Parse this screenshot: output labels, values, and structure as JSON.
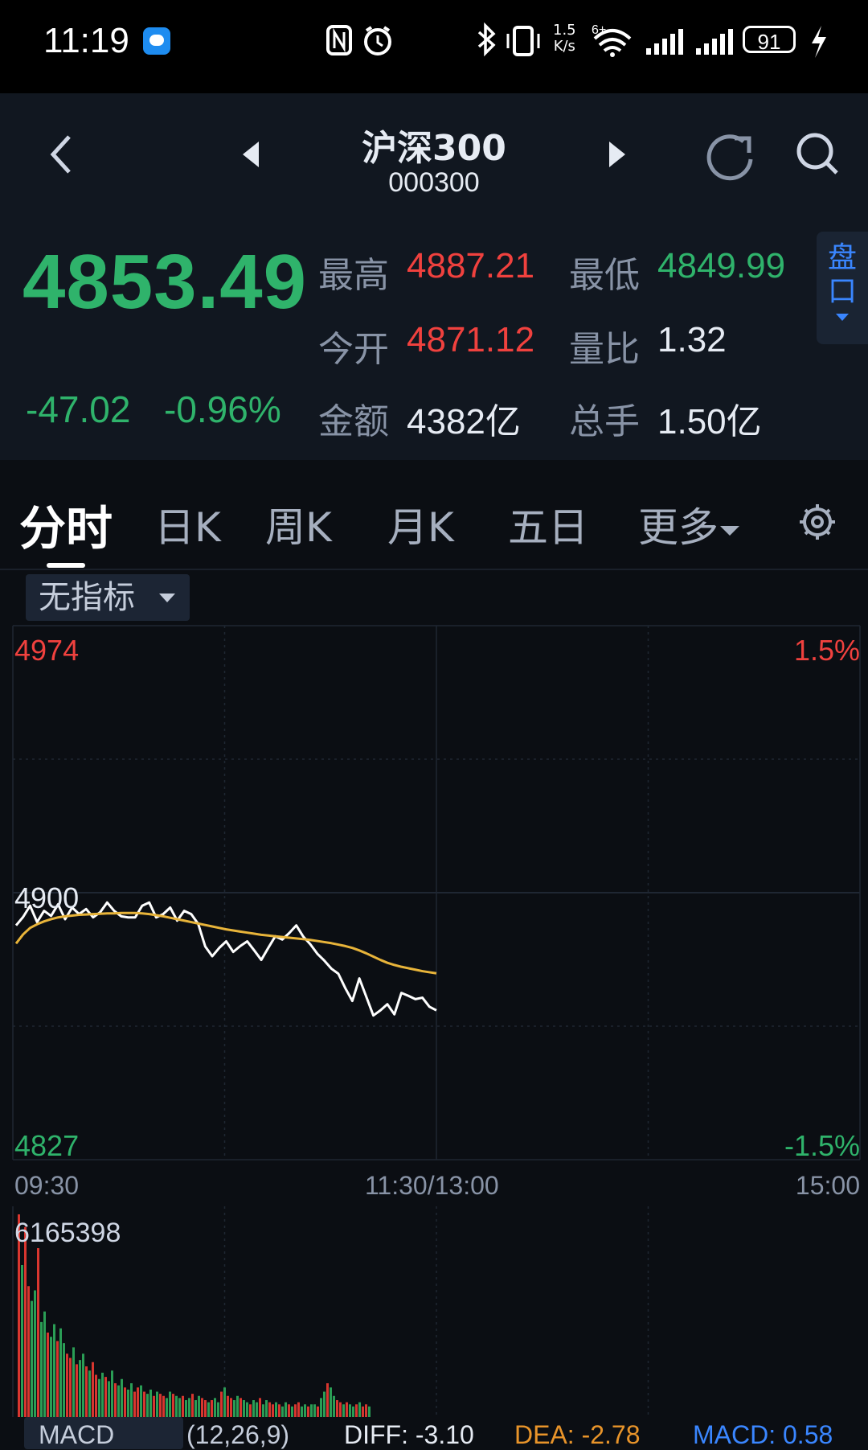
{
  "status_bar": {
    "time": "11:19",
    "net_speed_top": "1.5",
    "net_speed_bottom": "K/s",
    "battery": "91"
  },
  "header": {
    "title": "沪深300",
    "code": "000300",
    "back_icon": "chevron-left-icon",
    "prev_icon": "triangle-left-icon",
    "next_icon": "triangle-right-icon",
    "refresh_icon": "refresh-icon",
    "search_icon": "search-icon"
  },
  "quote": {
    "price": "4853.49",
    "change": "-47.02",
    "change_pct": "-0.96%",
    "stats": [
      {
        "label": "最高",
        "value": "4887.21"
      },
      {
        "label": "最低",
        "value": "4849.99"
      },
      {
        "label": "今开",
        "value": "4871.12"
      },
      {
        "label": "量比",
        "value": "1.32"
      },
      {
        "label": "金额",
        "value": "4382亿"
      },
      {
        "label": "总手",
        "value": "1.50亿"
      }
    ],
    "pankou_label_1": "盘",
    "pankou_label_2": "口",
    "colors": {
      "down": "#2fb36b",
      "up": "#f0413e"
    }
  },
  "tabs": [
    {
      "label": "分时",
      "active": true
    },
    {
      "label": "日K"
    },
    {
      "label": "周K"
    },
    {
      "label": "月K"
    },
    {
      "label": "五日"
    },
    {
      "label": "更多"
    }
  ],
  "indicator_select": "无指标",
  "chart_labels": {
    "y_max": "4974",
    "y_mid": "4900",
    "y_min": "4827",
    "pct_max": "1.5%",
    "pct_min": "-1.5%",
    "t_start": "09:30",
    "t_mid": "11:30/13:00",
    "t_end": "15:00",
    "volume_max": "6165398"
  },
  "macd": {
    "label": "MACD",
    "params": "(12,26,9)",
    "diff": "DIFF: -3.10",
    "dea": "DEA: -2.78",
    "macd": "MACD: 0.58"
  },
  "chart_data": {
    "type": "line",
    "ylim": [
      4827,
      4974
    ],
    "x_range_minutes": [
      0,
      240
    ],
    "series": [
      {
        "values": [
          4891.5,
          4893.8,
          4896.9,
          4892.4,
          4895.5,
          4894.1,
          4897.3,
          4893.2,
          4896.4,
          4894.6,
          4896.0,
          4893.7,
          4895.1,
          4897.8,
          4895.5,
          4894.0,
          4893.7,
          4893.7,
          4896.9,
          4897.8,
          4893.7,
          4894.6,
          4896.4,
          4892.8,
          4895.5,
          4894.6,
          4891.9,
          4885.7,
          4883.0,
          4885.3,
          4887.1,
          4884.2,
          4885.8,
          4887.1,
          4884.6,
          4882.0,
          4885.3,
          4888.5,
          4887.6,
          4889.4,
          4891.5,
          4888.4,
          4886.3,
          4883.7,
          4881.8,
          4879.6,
          4878.2,
          4874.2,
          4870.7,
          4876.9,
          4871.8,
          4866.7,
          4868.1,
          4869.8,
          4867.0,
          4872.9,
          4872.1,
          4871.2,
          4871.6,
          4869.1,
          4868.1
        ]
      },
      {
        "values": [
          4886.5,
          4889.0,
          4890.8,
          4891.8,
          4892.6,
          4893.2,
          4893.7,
          4894.0,
          4894.2,
          4894.4,
          4894.5,
          4894.6,
          4894.7,
          4894.8,
          4894.8,
          4894.9,
          4894.9,
          4894.9,
          4894.8,
          4894.6,
          4894.3,
          4894.0,
          4893.6,
          4893.2,
          4892.8,
          4892.4,
          4892.0,
          4891.6,
          4891.2,
          4890.8,
          4890.4,
          4890.1,
          4889.8,
          4889.5,
          4889.2,
          4888.9,
          4888.7,
          4888.5,
          4888.3,
          4888.1,
          4887.9,
          4887.7,
          4887.5,
          4887.2,
          4886.9,
          4886.6,
          4886.2,
          4885.8,
          4885.3,
          4884.6,
          4883.8,
          4882.9,
          4882.0,
          4881.2,
          4880.6,
          4880.1,
          4879.7,
          4879.3,
          4878.9,
          4878.6,
          4878.3
        ]
      }
    ],
    "colors": [
      "#ffffff",
      "#e8b43a"
    ],
    "volume": [
      96,
      72,
      90,
      62,
      55,
      60,
      80,
      45,
      50,
      40,
      38,
      44,
      36,
      42,
      35,
      30,
      28,
      33,
      25,
      27,
      30,
      24,
      22,
      26,
      20,
      18,
      21,
      19,
      17,
      22,
      16,
      15,
      18,
      14,
      13,
      16,
      12,
      14,
      15,
      12,
      11,
      13,
      10,
      12,
      11,
      10,
      9,
      12,
      11,
      10,
      9,
      10,
      8,
      9,
      11,
      8,
      10,
      9,
      8,
      7,
      8,
      9,
      7,
      12,
      14,
      10,
      9,
      8,
      10,
      9,
      8,
      7,
      6,
      8,
      7,
      9,
      6,
      8,
      7,
      6,
      7,
      6,
      5,
      7,
      6,
      5,
      6,
      7,
      5,
      6,
      5,
      6,
      6,
      5,
      9,
      12,
      16,
      14,
      10,
      8,
      7,
      6,
      7,
      6,
      5,
      6,
      7,
      5,
      6,
      5
    ]
  }
}
